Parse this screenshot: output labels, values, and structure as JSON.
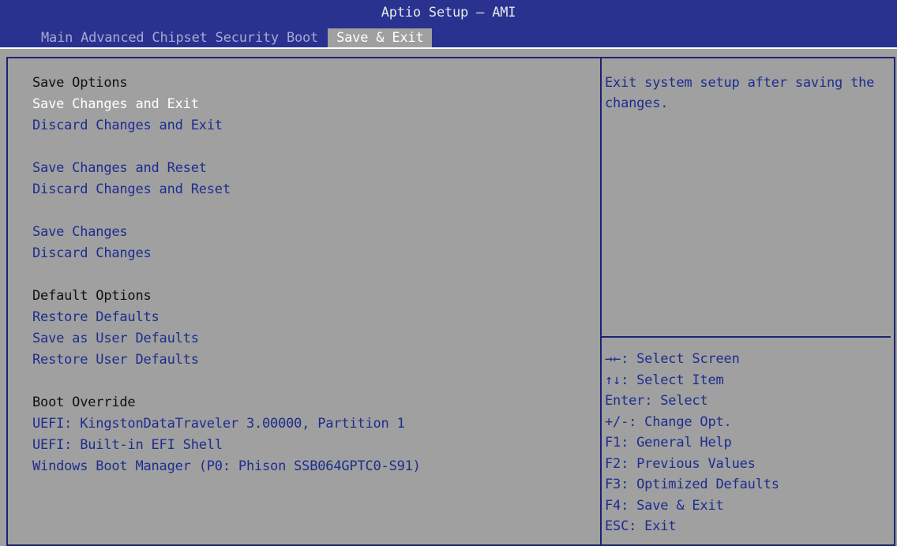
{
  "window": {
    "title": "Aptio Setup – AMI"
  },
  "tabs": [
    {
      "label": "Main",
      "active": false
    },
    {
      "label": "Advanced",
      "active": false
    },
    {
      "label": "Chipset",
      "active": false
    },
    {
      "label": "Security",
      "active": false
    },
    {
      "label": "Boot",
      "active": false
    },
    {
      "label": "Save & Exit",
      "active": true
    }
  ],
  "save_options": {
    "header": "Save Options",
    "items": [
      "Save Changes and Exit",
      "Discard Changes and Exit",
      "Save Changes and Reset",
      "Discard Changes and Reset",
      "Save Changes",
      "Discard Changes"
    ]
  },
  "default_options": {
    "header": "Default Options",
    "items": [
      "Restore Defaults",
      "Save as User Defaults",
      "Restore User Defaults"
    ]
  },
  "boot_override": {
    "header": "Boot Override",
    "items": [
      "UEFI: KingstonDataTraveler 3.00000, Partition 1",
      "UEFI: Built-in EFI Shell",
      "Windows Boot Manager (P0: Phison SSB064GPTC0-S91)"
    ]
  },
  "help_text": "Exit system setup after saving the changes.",
  "key_help": [
    {
      "key": "→←",
      "text": ": Select Screen"
    },
    {
      "key": "↑↓",
      "text": ": Select Item"
    },
    {
      "key": "Enter",
      "text": ": Select"
    },
    {
      "key": "+/-",
      "text": ": Change Opt."
    },
    {
      "key": "F1",
      "text": ": General Help"
    },
    {
      "key": "F2",
      "text": ": Previous Values"
    },
    {
      "key": "F3",
      "text": ": Optimized Defaults"
    },
    {
      "key": "F4",
      "text": ": Save & Exit"
    },
    {
      "key": "ESC",
      "text": ": Exit"
    }
  ],
  "colors": {
    "header_bg": "#2a3290",
    "body_bg": "#a0a0a0",
    "item_text": "#1d2d8e",
    "selected_text": "#ffffff",
    "header_text": "#101010"
  }
}
